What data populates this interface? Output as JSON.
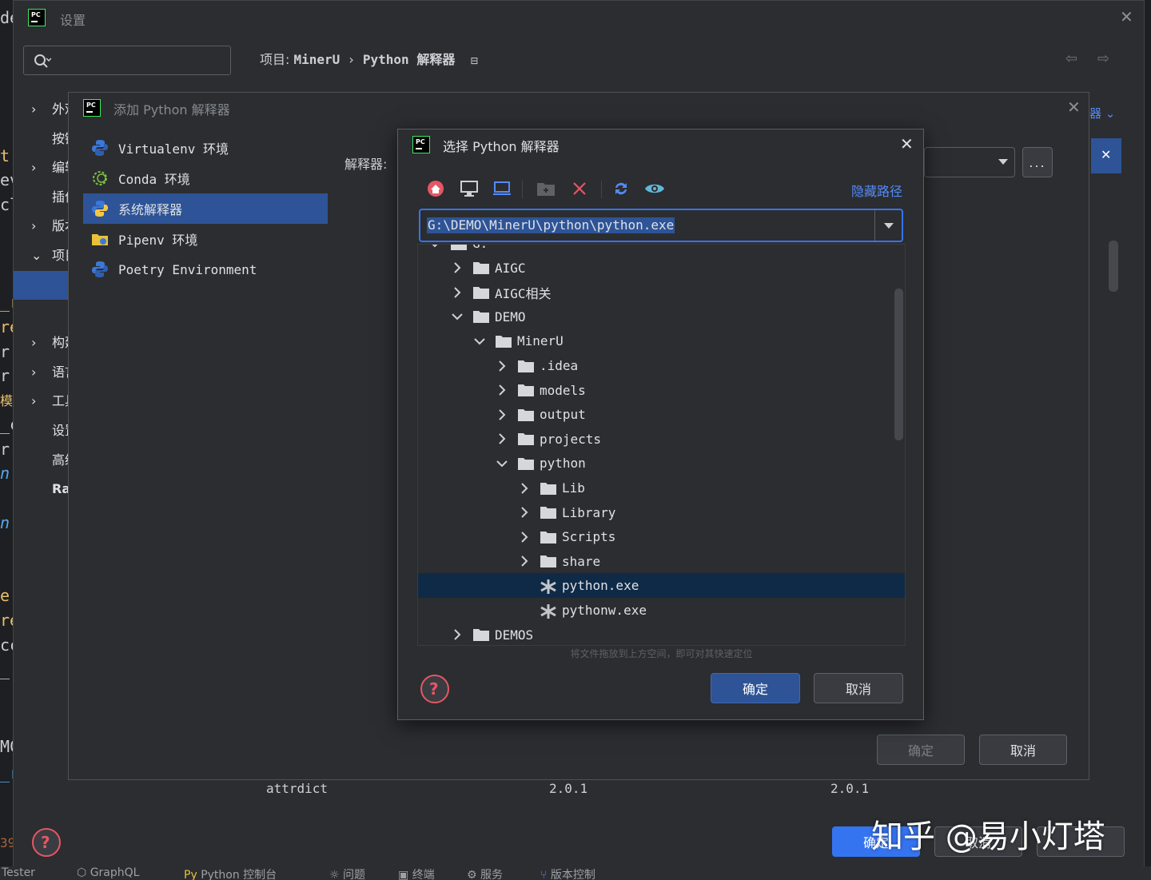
{
  "ide_strip": [
    "de",
    "t",
    "ev",
    "cl",
    "_r",
    "re",
    "r",
    "r",
    "模型",
    "_c",
    "r",
    "n",
    "n",
    "e",
    "re",
    "cc",
    "_",
    "MC",
    "_r",
    "39"
  ],
  "settings": {
    "title": "设置",
    "breadcrumb": {
      "prefix": "项目:",
      "project": "MinerU",
      "sep": "›",
      "page": "Python 解释器"
    },
    "nav_items": [
      "外观",
      "按键",
      "编辑",
      "插件",
      "版本",
      "项目",
      "构建",
      "语言",
      "工具",
      "设置",
      "高级",
      "Ra"
    ],
    "right_fragment": "器",
    "table_row": {
      "name": "attrdict",
      "version": "2.0.1",
      "latest": "2.0.1"
    },
    "ok_label": "确定",
    "cancel_label": "取消"
  },
  "add_dialog": {
    "title": "添加 Python 解释器",
    "interpreter_label": "解释器:",
    "types": [
      "Virtualenv 环境",
      "Conda 环境",
      "系统解释器",
      "Pipenv 环境",
      "Poetry Environment"
    ],
    "selected_type": 2,
    "ok_label": "确定",
    "cancel_label": "取消",
    "browse_label": "..."
  },
  "select_dialog": {
    "title": "选择 Python 解释器",
    "hide_path_label": "隐藏路径",
    "path_value": "G:\\DEMO\\MinerU\\python\\python.exe",
    "tree": [
      {
        "name": "G:",
        "depth": 0,
        "type": "folder",
        "state": "open"
      },
      {
        "name": "AIGC",
        "depth": 1,
        "type": "folder",
        "state": "closed"
      },
      {
        "name": "AIGC相关",
        "depth": 1,
        "type": "folder",
        "state": "closed"
      },
      {
        "name": "DEMO",
        "depth": 1,
        "type": "folder",
        "state": "open"
      },
      {
        "name": "MinerU",
        "depth": 2,
        "type": "folder",
        "state": "open"
      },
      {
        "name": ".idea",
        "depth": 3,
        "type": "folder",
        "state": "closed"
      },
      {
        "name": "models",
        "depth": 3,
        "type": "folder",
        "state": "closed"
      },
      {
        "name": "output",
        "depth": 3,
        "type": "folder",
        "state": "closed"
      },
      {
        "name": "projects",
        "depth": 3,
        "type": "folder",
        "state": "closed"
      },
      {
        "name": "python",
        "depth": 3,
        "type": "folder",
        "state": "open"
      },
      {
        "name": "Lib",
        "depth": 4,
        "type": "folder",
        "state": "closed"
      },
      {
        "name": "Library",
        "depth": 4,
        "type": "folder",
        "state": "closed"
      },
      {
        "name": "Scripts",
        "depth": 4,
        "type": "folder",
        "state": "closed"
      },
      {
        "name": "share",
        "depth": 4,
        "type": "folder",
        "state": "closed"
      },
      {
        "name": "python.exe",
        "depth": 4,
        "type": "file",
        "state": "selected"
      },
      {
        "name": "pythonw.exe",
        "depth": 4,
        "type": "file",
        "state": "none"
      },
      {
        "name": "DEMOS",
        "depth": 1,
        "type": "folder",
        "state": "closed"
      }
    ],
    "drop_hint": "将文件拖放到上方空间，即可对其快速定位",
    "ok_label": "确定",
    "cancel_label": "取消"
  },
  "bottom_tabs": [
    "Tester",
    "GraphQL",
    "Python 控制台",
    "问题",
    "终端",
    "服务",
    "版本控制"
  ],
  "watermark": "知乎 @易小灯塔",
  "colors": {
    "accent": "#3574f0",
    "selection": "#2e5497",
    "tree_selection": "#0f2a47",
    "danger": "#e55765"
  }
}
